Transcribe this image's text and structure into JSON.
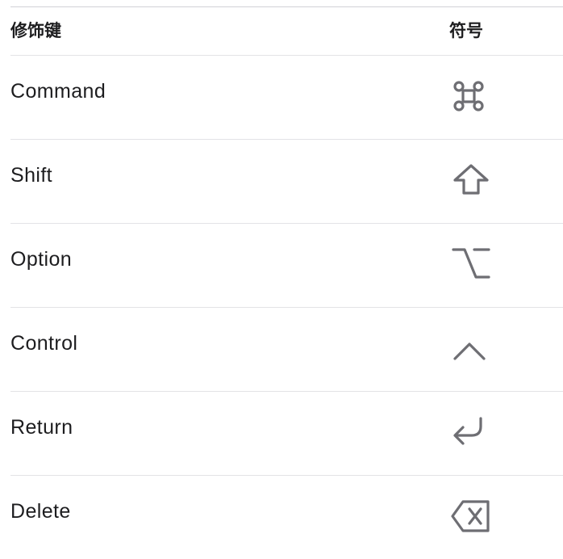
{
  "table": {
    "headers": {
      "modifier_key": "修饰键",
      "symbol": "符号"
    },
    "rows": [
      {
        "key": "Command",
        "symbol_icon": "command-symbol-icon"
      },
      {
        "key": "Shift",
        "symbol_icon": "shift-symbol-icon"
      },
      {
        "key": "Option",
        "symbol_icon": "option-symbol-icon"
      },
      {
        "key": "Control",
        "symbol_icon": "control-symbol-icon"
      },
      {
        "key": "Return",
        "symbol_icon": "return-symbol-icon"
      },
      {
        "key": "Delete",
        "symbol_icon": "delete-symbol-icon"
      }
    ]
  },
  "colors": {
    "text": "#1d1d1f",
    "symbol": "#6e6e73",
    "divider": "#e3e3e6"
  }
}
